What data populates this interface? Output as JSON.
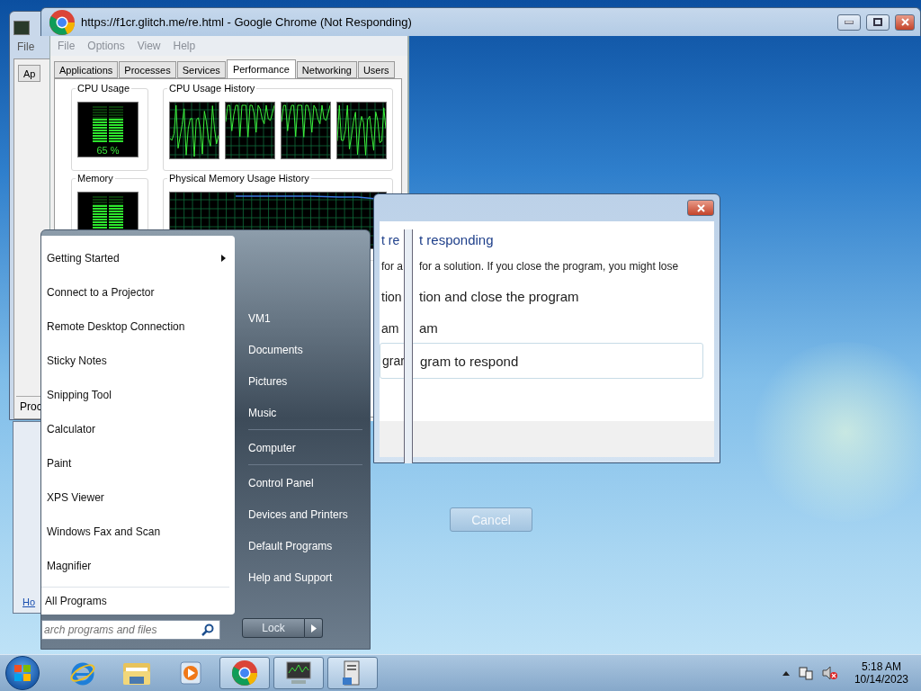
{
  "back_window": {
    "menu": [
      "File"
    ],
    "tabs": [
      {
        "label": "Ap",
        "selected": false
      }
    ],
    "status": "Proc",
    "link": "Ho"
  },
  "browser_window": {
    "title": "https://f1cr.glitch.me/re.html - Google Chrome (Not Responding)"
  },
  "task_manager": {
    "menu": [
      "File",
      "Options",
      "View",
      "Help"
    ],
    "tabs": [
      {
        "label": "Applications",
        "selected": false
      },
      {
        "label": "Processes",
        "selected": false
      },
      {
        "label": "Services",
        "selected": false
      },
      {
        "label": "Performance",
        "selected": true
      },
      {
        "label": "Networking",
        "selected": false
      },
      {
        "label": "Users",
        "selected": false
      }
    ],
    "cpu_usage": {
      "label": "CPU Usage",
      "reading": "65 %",
      "level": 0.65
    },
    "cpu_history": {
      "label": "CPU Usage History"
    },
    "memory": {
      "label": "Memory",
      "level": 0.75
    },
    "memory_history": {
      "label": "Physical Memory Usage History"
    }
  },
  "dialog": {
    "lines": [
      {
        "kind": "heading",
        "ghost": "t re",
        "text": "t responding"
      },
      {
        "kind": "body",
        "ghost": "for a",
        "text": "for a solution. If you close the program, you might lose"
      },
      {
        "kind": "option",
        "ghost": "tion",
        "text": "tion and close the program"
      },
      {
        "kind": "option",
        "ghost": "am",
        "text": "am"
      },
      {
        "kind": "boxed",
        "ghost": "grar",
        "text": "gram to respond"
      }
    ],
    "cancel": "Cancel"
  },
  "start_menu": {
    "programs": [
      {
        "label": "Getting Started",
        "submenu": true
      },
      {
        "label": "Connect to a Projector",
        "submenu": false
      },
      {
        "label": "Remote Desktop Connection",
        "submenu": false
      },
      {
        "label": "Sticky Notes",
        "submenu": false
      },
      {
        "label": "Snipping Tool",
        "submenu": false
      },
      {
        "label": "Calculator",
        "submenu": false
      },
      {
        "label": "Paint",
        "submenu": false
      },
      {
        "label": "XPS Viewer",
        "submenu": false
      },
      {
        "label": "Windows Fax and Scan",
        "submenu": false
      },
      {
        "label": "Magnifier",
        "submenu": false
      }
    ],
    "all_programs": "All Programs",
    "search": {
      "placeholder": "arch programs and files"
    },
    "places": [
      {
        "label": "VM1",
        "separator_after": false
      },
      {
        "label": "Documents",
        "separator_after": false
      },
      {
        "label": "Pictures",
        "separator_after": false
      },
      {
        "label": "Music",
        "separator_after": true
      },
      {
        "label": "Computer",
        "separator_after": true
      },
      {
        "label": "Control Panel",
        "separator_after": false
      },
      {
        "label": "Devices and Printers",
        "separator_after": false
      },
      {
        "label": "Default Programs",
        "separator_after": false
      },
      {
        "label": "Help and Support",
        "separator_after": false
      }
    ],
    "lock": "Lock"
  },
  "taskbar": {
    "apps": [
      {
        "kind": "browser-e",
        "running": false
      },
      {
        "kind": "folder",
        "running": false
      },
      {
        "kind": "media",
        "running": false
      },
      {
        "kind": "chrome",
        "running": true
      },
      {
        "kind": "monitor",
        "running": true
      },
      {
        "kind": "server",
        "running": true
      }
    ],
    "time": "5:18 AM",
    "date": "10/14/2023"
  }
}
